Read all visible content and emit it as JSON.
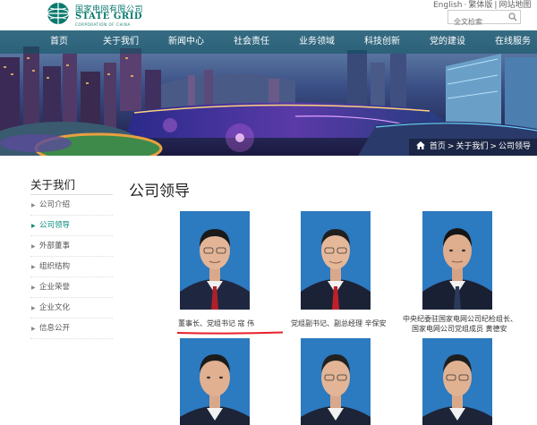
{
  "header": {
    "logo_cn": "国家电网有限公司",
    "logo_en": "STATE GRID",
    "logo_sub": "CORPORATION OF CHINA",
    "lang_links": [
      "English",
      "繁体版",
      "网站地图"
    ],
    "search_placeholder": "全文检索"
  },
  "nav": {
    "items": [
      "首页",
      "关于我们",
      "新闻中心",
      "社会责任",
      "业务领域",
      "科技创新",
      "党的建设",
      "在线服务"
    ]
  },
  "breadcrumb": {
    "items": [
      "首页",
      "关于我们",
      "公司领导"
    ],
    "separator": ">"
  },
  "sidebar": {
    "title": "关于我们",
    "items": [
      "公司介绍",
      "公司领导",
      "外部董事",
      "组织结构",
      "企业荣誉",
      "企业文化",
      "信息公开"
    ],
    "active_index": 1
  },
  "main": {
    "title": "公司领导",
    "leaders": [
      {
        "caption": "董事长、党组书记 寇 伟"
      },
      {
        "caption": "党组副书记、副总经理 辛保安"
      },
      {
        "caption_line1": "中央纪委驻国家电网公司纪检组长、",
        "caption_line2": "国家电网公司党组成员 黄德安"
      },
      {
        "caption": ""
      },
      {
        "caption": ""
      },
      {
        "caption": ""
      }
    ]
  },
  "colors": {
    "brand": "#0b7a6e",
    "active": "#0b8a7e",
    "photo_bg": "#2c7ac0",
    "annotation": "#e8202a"
  }
}
